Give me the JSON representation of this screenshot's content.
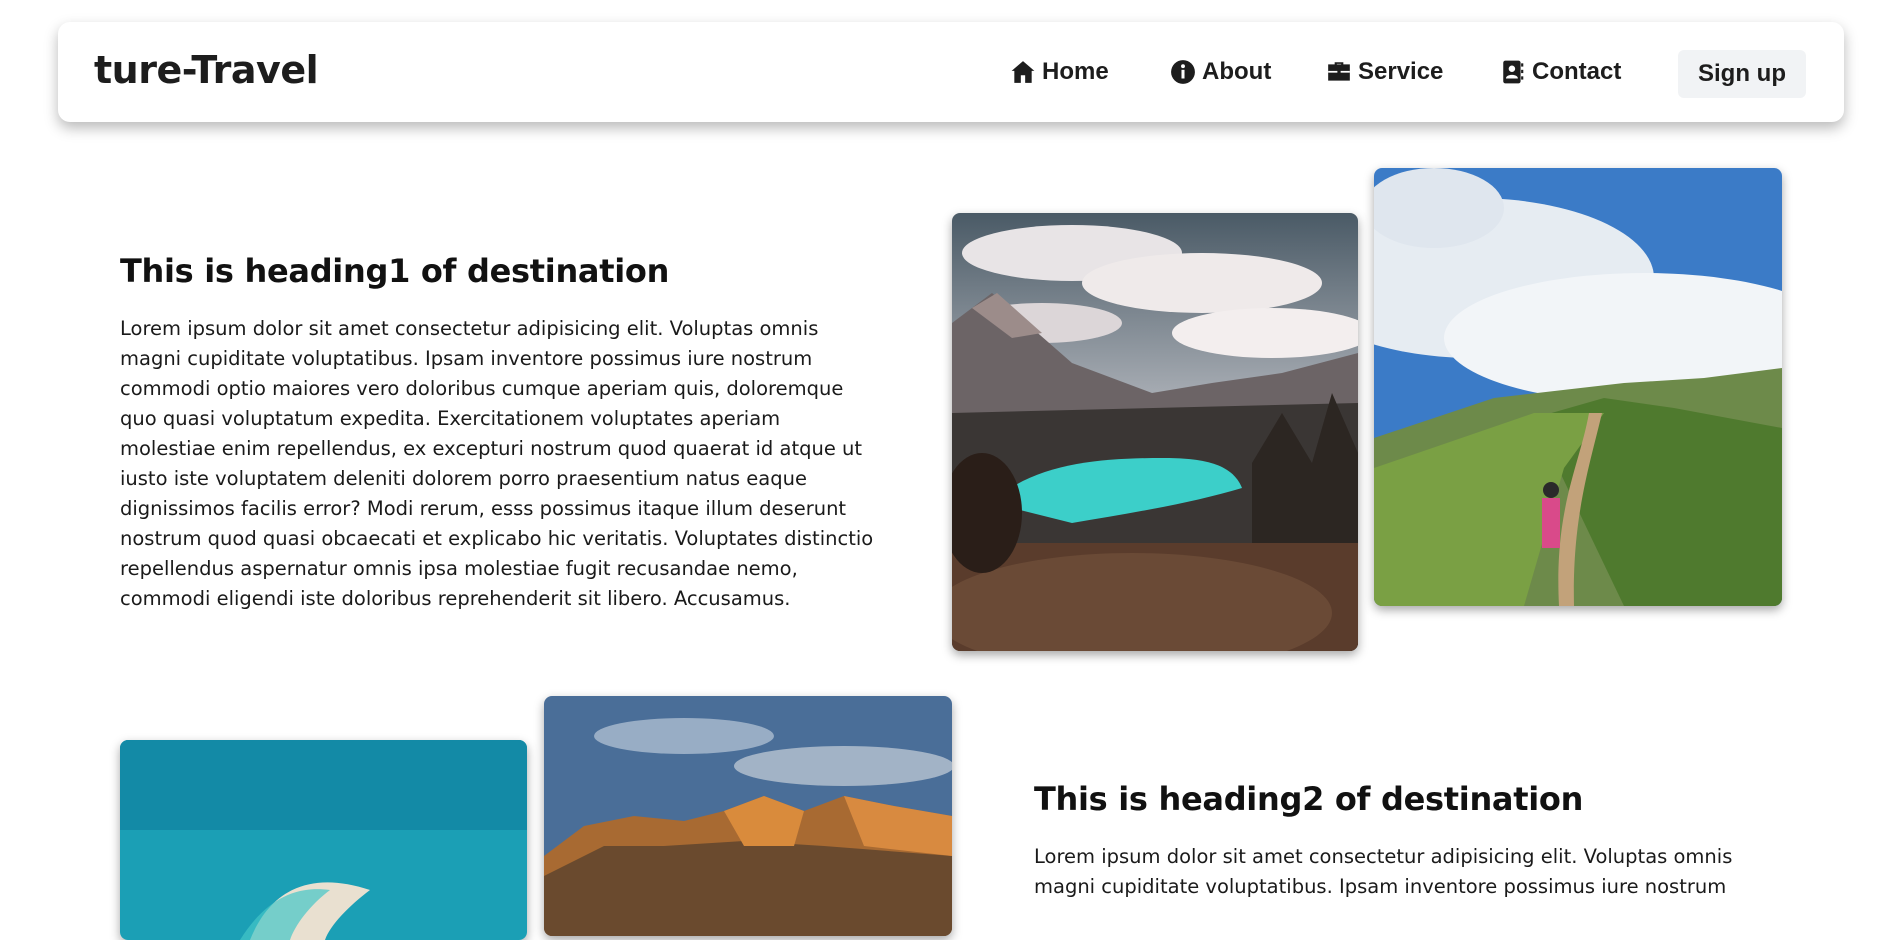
{
  "brand": {
    "name": "ture-Travel"
  },
  "nav": {
    "items": [
      {
        "label": "Home",
        "icon": "home-icon"
      },
      {
        "label": "About",
        "icon": "info-circle-icon"
      },
      {
        "label": "Service",
        "icon": "briefcase-icon"
      },
      {
        "label": "Contact",
        "icon": "address-book-icon"
      }
    ],
    "signup_label": "Sign up"
  },
  "sections": [
    {
      "heading": "This is heading1 of destination",
      "body": "Lorem ipsum dolor sit amet consectetur adipisicing elit. Voluptas omnis magni cupiditate voluptatibus. Ipsam inventore possimus iure nostrum commodi optio maiores vero doloribus cumque aperiam quis, doloremque quo quasi voluptatum expedita. Exercitationem voluptates aperiam molestiae enim repellendus, ex excepturi nostrum quod quaerat id atque ut iusto iste voluptatem deleniti dolorem porro praesentium natus eaque dignissimos facilis error? Modi rerum, esss possimus itaque illum deserunt nostrum quod quasi obcaecati et explicabo hic veritatis. Voluptates distinctio repellendus aspernatur omnis ipsa molestiae fugit recusandae nemo, commodi eligendi iste doloribus reprehenderit sit libero. Accusamus."
    },
    {
      "heading": "This is heading2 of destination",
      "body": "Lorem ipsum dolor sit amet consectetur adipisicing elit. Voluptas omnis magni cupiditate voluptatibus. Ipsam inventore possimus iure nostrum"
    }
  ],
  "colors": {
    "text": "#1d1d1d",
    "navbar_bg": "#ffffff",
    "signup_bg": "#f1f3f5",
    "lake": "#3ccfc9",
    "sea": "#1b9fb5"
  }
}
